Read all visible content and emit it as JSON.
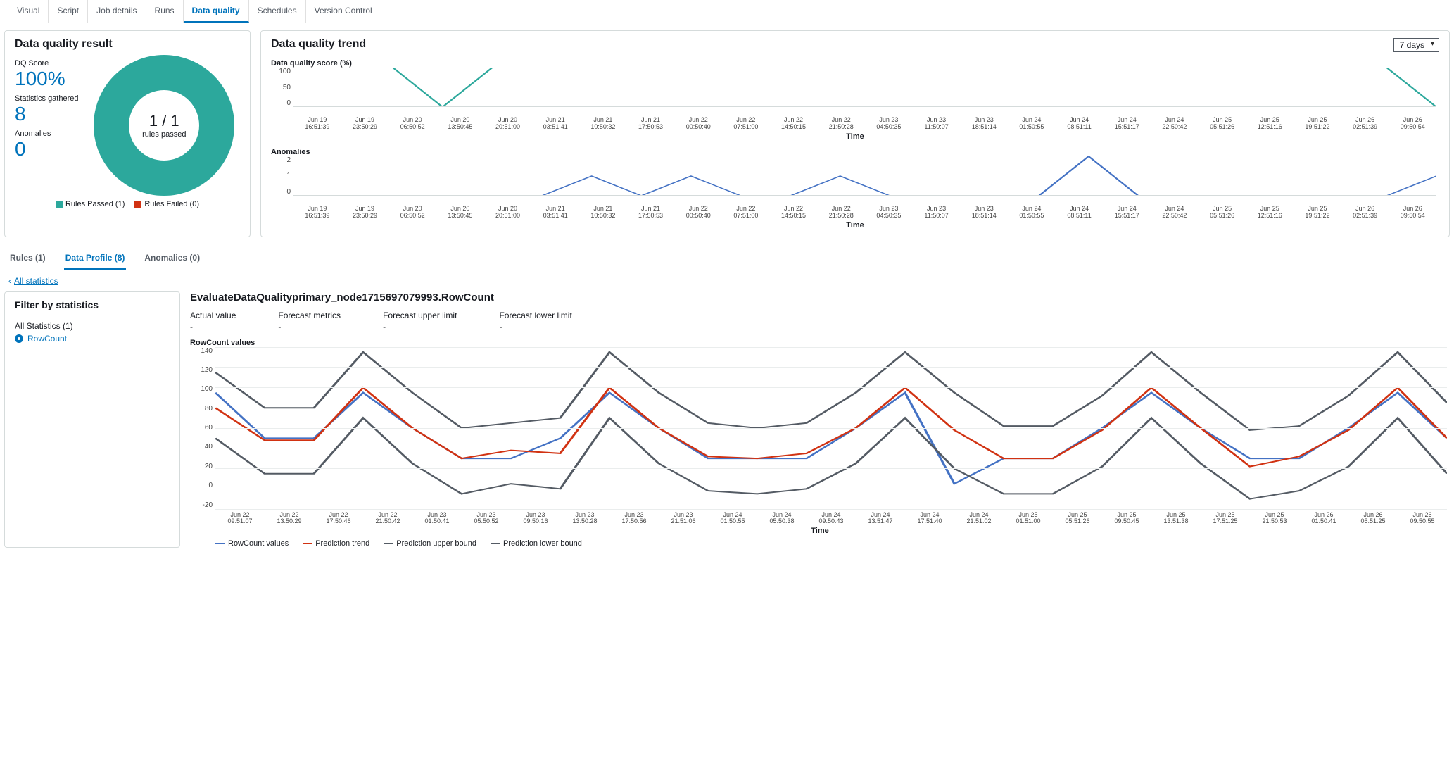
{
  "top_tabs": [
    "Visual",
    "Script",
    "Job details",
    "Runs",
    "Data quality",
    "Schedules",
    "Version Control"
  ],
  "top_tabs_active": 4,
  "result": {
    "title": "Data quality result",
    "score_label": "DQ Score",
    "score_value": "100%",
    "stats_label": "Statistics gathered",
    "stats_value": "8",
    "anom_label": "Anomalies",
    "anom_value": "0",
    "donut_num": "1 / 1",
    "donut_sub": "rules passed",
    "legend_pass": "Rules Passed (1)",
    "legend_fail": "Rules Failed (0)"
  },
  "trend": {
    "title": "Data quality trend",
    "range": "7 days",
    "time_label": "Time",
    "score_chart_title": "Data quality score (%)",
    "anom_chart_title": "Anomalies",
    "x_ticks": [
      [
        "Jun 19",
        "16:51:39"
      ],
      [
        "Jun 19",
        "23:50:29"
      ],
      [
        "Jun 20",
        "06:50:52"
      ],
      [
        "Jun 20",
        "13:50:45"
      ],
      [
        "Jun 20",
        "20:51:00"
      ],
      [
        "Jun 21",
        "03:51:41"
      ],
      [
        "Jun 21",
        "10:50:32"
      ],
      [
        "Jun 21",
        "17:50:53"
      ],
      [
        "Jun 22",
        "00:50:40"
      ],
      [
        "Jun 22",
        "07:51:00"
      ],
      [
        "Jun 22",
        "14:50:15"
      ],
      [
        "Jun 22",
        "21:50:28"
      ],
      [
        "Jun 23",
        "04:50:35"
      ],
      [
        "Jun 23",
        "11:50:07"
      ],
      [
        "Jun 23",
        "18:51:14"
      ],
      [
        "Jun 24",
        "01:50:55"
      ],
      [
        "Jun 24",
        "08:51:11"
      ],
      [
        "Jun 24",
        "15:51:17"
      ],
      [
        "Jun 24",
        "22:50:42"
      ],
      [
        "Jun 25",
        "05:51:26"
      ],
      [
        "Jun 25",
        "12:51:16"
      ],
      [
        "Jun 25",
        "19:51:22"
      ],
      [
        "Jun 26",
        "02:51:39"
      ],
      [
        "Jun 26",
        "09:50:54"
      ]
    ]
  },
  "chart_data": [
    {
      "type": "line",
      "title": "Data quality score (%)",
      "ylabel": "",
      "xlabel": "Time",
      "ylim": [
        0,
        100
      ],
      "y_ticks": [
        0,
        50,
        100
      ],
      "x_categories": [
        "Jun 19 16:51:39",
        "Jun 19 23:50:29",
        "Jun 20 06:50:52",
        "Jun 20 13:50:45",
        "Jun 20 20:51:00",
        "Jun 21 03:51:41",
        "Jun 21 10:50:32",
        "Jun 21 17:50:53",
        "Jun 22 00:50:40",
        "Jun 22 07:51:00",
        "Jun 22 14:50:15",
        "Jun 22 21:50:28",
        "Jun 23 04:50:35",
        "Jun 23 11:50:07",
        "Jun 23 18:51:14",
        "Jun 24 01:50:55",
        "Jun 24 08:51:11",
        "Jun 24 15:51:17",
        "Jun 24 22:50:42",
        "Jun 25 05:51:26",
        "Jun 25 12:51:16",
        "Jun 25 19:51:22",
        "Jun 26 02:51:39",
        "Jun 26 09:50:54"
      ],
      "values": [
        100,
        100,
        100,
        0,
        100,
        100,
        100,
        100,
        100,
        100,
        100,
        100,
        100,
        100,
        100,
        100,
        100,
        100,
        100,
        100,
        100,
        100,
        100,
        0
      ]
    },
    {
      "type": "line",
      "title": "Anomalies",
      "ylabel": "",
      "xlabel": "Time",
      "ylim": [
        0,
        2
      ],
      "y_ticks": [
        0,
        1,
        2
      ],
      "x_categories": [
        "Jun 19 16:51:39",
        "Jun 19 23:50:29",
        "Jun 20 06:50:52",
        "Jun 20 13:50:45",
        "Jun 20 20:51:00",
        "Jun 21 03:51:41",
        "Jun 21 10:50:32",
        "Jun 21 17:50:53",
        "Jun 22 00:50:40",
        "Jun 22 07:51:00",
        "Jun 22 14:50:15",
        "Jun 22 21:50:28",
        "Jun 23 04:50:35",
        "Jun 23 11:50:07",
        "Jun 23 18:51:14",
        "Jun 24 01:50:55",
        "Jun 24 08:51:11",
        "Jun 24 15:51:17",
        "Jun 24 22:50:42",
        "Jun 25 05:51:26",
        "Jun 25 12:51:16",
        "Jun 25 19:51:22",
        "Jun 26 02:51:39",
        "Jun 26 09:50:54"
      ],
      "values": [
        0,
        0,
        0,
        0,
        0,
        0,
        1,
        0,
        1,
        0,
        0,
        1,
        0,
        0,
        0,
        0,
        2,
        0,
        0,
        0,
        0,
        0,
        0,
        1
      ]
    },
    {
      "type": "line",
      "title": "RowCount values",
      "ylabel": "",
      "xlabel": "Time",
      "ylim": [
        -20,
        140
      ],
      "y_ticks": [
        -20,
        0,
        20,
        40,
        60,
        80,
        100,
        120,
        140
      ],
      "x_categories": [
        "Jun 22 09:51:07",
        "Jun 22 13:50:29",
        "Jun 22 17:50:46",
        "Jun 22 21:50:42",
        "Jun 23 01:50:41",
        "Jun 23 05:50:52",
        "Jun 23 09:50:16",
        "Jun 23 13:50:28",
        "Jun 23 17:50:56",
        "Jun 23 21:51:06",
        "Jun 24 01:50:55",
        "Jun 24 05:50:38",
        "Jun 24 09:50:43",
        "Jun 24 13:51:47",
        "Jun 24 17:51:40",
        "Jun 24 21:51:02",
        "Jun 25 01:51:00",
        "Jun 25 05:51:26",
        "Jun 25 09:50:45",
        "Jun 25 13:51:38",
        "Jun 25 17:51:25",
        "Jun 25 21:50:53",
        "Jun 26 01:50:41",
        "Jun 26 05:51:25",
        "Jun 26 09:50:55"
      ],
      "series": [
        {
          "name": "RowCount values",
          "color": "#4472c4",
          "values": [
            95,
            50,
            50,
            95,
            60,
            30,
            30,
            50,
            95,
            60,
            30,
            30,
            30,
            60,
            95,
            5,
            30,
            30,
            60,
            95,
            60,
            30,
            30,
            60,
            95,
            50
          ]
        },
        {
          "name": "Prediction trend",
          "color": "#d13212",
          "values": [
            80,
            48,
            48,
            100,
            60,
            30,
            38,
            35,
            100,
            60,
            32,
            30,
            35,
            60,
            100,
            58,
            30,
            30,
            58,
            100,
            60,
            22,
            32,
            58,
            100,
            50
          ]
        },
        {
          "name": "Prediction upper bound",
          "color": "#545b64",
          "values": [
            115,
            80,
            80,
            135,
            95,
            60,
            65,
            70,
            135,
            95,
            65,
            60,
            65,
            95,
            135,
            95,
            62,
            62,
            92,
            135,
            95,
            58,
            62,
            92,
            135,
            85
          ]
        },
        {
          "name": "Prediction lower bound",
          "color": "#545b64",
          "values": [
            50,
            15,
            15,
            70,
            25,
            -5,
            5,
            0,
            70,
            25,
            -2,
            -5,
            0,
            25,
            70,
            20,
            -5,
            -5,
            22,
            70,
            25,
            -10,
            -2,
            22,
            70,
            15
          ]
        }
      ],
      "legend": [
        "RowCount values",
        "Prediction trend",
        "Prediction upper bound",
        "Prediction lower bound"
      ]
    }
  ],
  "sub_tabs": [
    "Rules (1)",
    "Data Profile (8)",
    "Anomalies (0)"
  ],
  "sub_tabs_active": 1,
  "back_link": "All statistics",
  "filter": {
    "title": "Filter by statistics",
    "all_label": "All Statistics (1)",
    "item": "RowCount"
  },
  "detail": {
    "title": "EvaluateDataQualityprimary_node1715697079993.RowCount",
    "metrics": [
      {
        "label": "Actual value",
        "value": "-"
      },
      {
        "label": "Forecast metrics",
        "value": "-"
      },
      {
        "label": "Forecast upper limit",
        "value": "-"
      },
      {
        "label": "Forecast lower limit",
        "value": "-"
      }
    ],
    "chart_title": "RowCount values",
    "time_label": "Time",
    "x_ticks": [
      [
        "Jun 22",
        "09:51:07"
      ],
      [
        "Jun 22",
        "13:50:29"
      ],
      [
        "Jun 22",
        "17:50:46"
      ],
      [
        "Jun 22",
        "21:50:42"
      ],
      [
        "Jun 23",
        "01:50:41"
      ],
      [
        "Jun 23",
        "05:50:52"
      ],
      [
        "Jun 23",
        "09:50:16"
      ],
      [
        "Jun 23",
        "13:50:28"
      ],
      [
        "Jun 23",
        "17:50:56"
      ],
      [
        "Jun 23",
        "21:51:06"
      ],
      [
        "Jun 24",
        "01:50:55"
      ],
      [
        "Jun 24",
        "05:50:38"
      ],
      [
        "Jun 24",
        "09:50:43"
      ],
      [
        "Jun 24",
        "13:51:47"
      ],
      [
        "Jun 24",
        "17:51:40"
      ],
      [
        "Jun 24",
        "21:51:02"
      ],
      [
        "Jun 25",
        "01:51:00"
      ],
      [
        "Jun 25",
        "05:51:26"
      ],
      [
        "Jun 25",
        "09:50:45"
      ],
      [
        "Jun 25",
        "13:51:38"
      ],
      [
        "Jun 25",
        "17:51:25"
      ],
      [
        "Jun 25",
        "21:50:53"
      ],
      [
        "Jun 26",
        "01:50:41"
      ],
      [
        "Jun 26",
        "05:51:25"
      ],
      [
        "Jun 26",
        "09:50:55"
      ]
    ]
  },
  "colors": {
    "teal": "#2ca89c",
    "blue": "#0073bb",
    "red": "#d13212",
    "grey": "#545b64",
    "seriesBlue": "#4472c4"
  }
}
